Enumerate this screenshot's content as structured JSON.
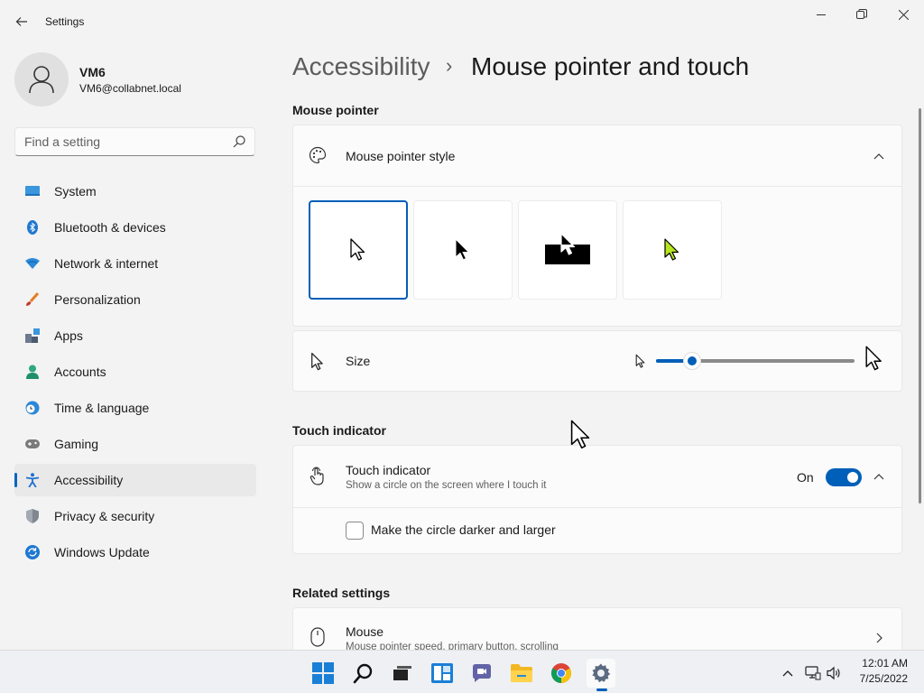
{
  "window": {
    "title": "Settings"
  },
  "profile": {
    "name": "VM6",
    "email": "VM6@collabnet.local"
  },
  "search": {
    "placeholder": "Find a setting"
  },
  "sidebar": {
    "items": [
      {
        "label": "System",
        "icon": "monitor-icon"
      },
      {
        "label": "Bluetooth & devices",
        "icon": "bluetooth-icon"
      },
      {
        "label": "Network & internet",
        "icon": "wifi-icon"
      },
      {
        "label": "Personalization",
        "icon": "brush-icon"
      },
      {
        "label": "Apps",
        "icon": "apps-icon"
      },
      {
        "label": "Accounts",
        "icon": "person-icon"
      },
      {
        "label": "Time & language",
        "icon": "clock-globe-icon"
      },
      {
        "label": "Gaming",
        "icon": "gamepad-icon"
      },
      {
        "label": "Accessibility",
        "icon": "accessibility-icon",
        "active": true
      },
      {
        "label": "Privacy & security",
        "icon": "shield-icon"
      },
      {
        "label": "Windows Update",
        "icon": "update-icon"
      }
    ]
  },
  "breadcrumb": {
    "parent": "Accessibility",
    "separator": "›",
    "current": "Mouse pointer and touch"
  },
  "mouse_pointer": {
    "section_title": "Mouse pointer",
    "style_label": "Mouse pointer style",
    "style_options": [
      "white",
      "black",
      "inverted",
      "custom"
    ],
    "selected_style": "white",
    "custom_color": "#b5e61d",
    "size_label": "Size",
    "size_slider_value": 0.15
  },
  "touch": {
    "section_title": "Touch indicator",
    "label": "Touch indicator",
    "description": "Show a circle on the screen where I touch it",
    "toggle_state": "On",
    "checkbox_label": "Make the circle darker and larger",
    "checkbox_checked": false
  },
  "related": {
    "section_title": "Related settings",
    "mouse_label": "Mouse",
    "mouse_desc": "Mouse pointer speed, primary button, scrolling"
  },
  "taskbar": {
    "apps": [
      "start-icon",
      "search-icon",
      "task-view-icon",
      "widgets-icon",
      "teams-chat-icon",
      "file-explorer-icon",
      "chrome-icon",
      "settings-icon"
    ],
    "time": "12:01 AM",
    "date": "7/25/2022"
  },
  "colors": {
    "accent": "#005fb8",
    "background": "#f3f3f3",
    "card": "#fbfbfb"
  }
}
